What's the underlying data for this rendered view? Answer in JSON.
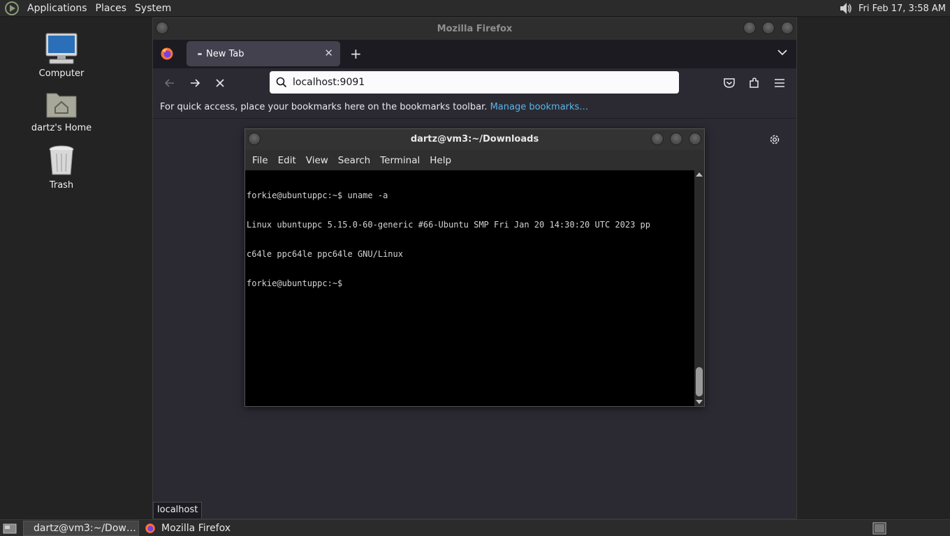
{
  "top_panel": {
    "menus": [
      "Applications",
      "Places",
      "System"
    ],
    "clock": "Fri Feb 17,  3:58 AM"
  },
  "desktop": {
    "icons": [
      {
        "label": "Computer",
        "icon": "computer-icon"
      },
      {
        "label": "dartz's Home",
        "icon": "home-folder-icon"
      },
      {
        "label": "Trash",
        "icon": "trash-icon"
      }
    ]
  },
  "firefox": {
    "window_title": "Mozilla Firefox",
    "tab_title": "New Tab",
    "url": "localhost:9091",
    "bookmarks_hint": "For quick access, place your bookmarks here on the bookmarks toolbar.",
    "manage_bookmarks": "Manage bookmarks…",
    "status_url": "localhost"
  },
  "terminal": {
    "title": "dartz@vm3:~/Downloads",
    "menus": [
      "File",
      "Edit",
      "View",
      "Search",
      "Terminal",
      "Help"
    ],
    "lines": [
      "forkie@ubuntuppc:~$ uname -a",
      "Linux ubuntuppc 5.15.0-60-generic #66-Ubuntu SMP Fri Jan 20 14:30:20 UTC 2023 pp",
      "c64le ppc64le ppc64le GNU/Linux",
      "forkie@ubuntuppc:~$ "
    ]
  },
  "taskbar": {
    "items": [
      {
        "label": "dartz@vm3:~/Dow…",
        "icon": "terminal-icon",
        "active": true
      },
      {
        "label": "Mozilla Firefox",
        "icon": "firefox-icon",
        "active": false
      }
    ]
  },
  "colors": {
    "firefox_bg": "#2b2a33",
    "link": "#57b6e9",
    "terminal_bg": "#000000"
  }
}
